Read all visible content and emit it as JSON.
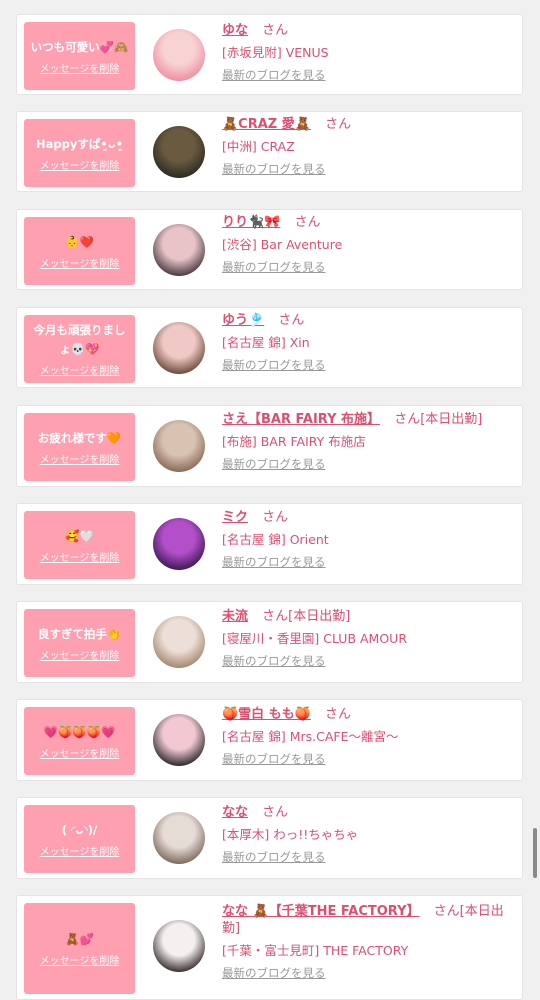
{
  "messages": [
    {
      "text": "いつも可愛い💞🙈",
      "delete": "メッセージを削除",
      "name": "ゆな",
      "san": "さん",
      "shop": "[赤坂見附] VENUS",
      "blog": "最新のブログを見る",
      "avatar_colors": [
        "#f7d3d3",
        "#f08ea0"
      ]
    },
    {
      "text": "Happyすぱ•͈ᴗ•͈",
      "delete": "メッセージを削除",
      "name": "🧸CRAZ 愛🧸",
      "san": "さん",
      "shop": "[中洲] CRAZ",
      "blog": "最新のブログを見る",
      "avatar_colors": [
        "#6a5a3f",
        "#2b2a22"
      ]
    },
    {
      "text": "👶❤️",
      "delete": "メッセージを削除",
      "name": "りり🐈‍⬛🎀",
      "san": "さん",
      "shop": "[渋谷] Bar Aventure",
      "blog": "最新のブログを見る",
      "avatar_colors": [
        "#e8c4c8",
        "#4a3a40"
      ]
    },
    {
      "text": "今月も頑張りましょ💀💖",
      "delete": "メッセージを削除",
      "name": "ゆう🎐",
      "san": "さん",
      "shop": "[名古屋 錦] Xin",
      "blog": "最新のブログを見る",
      "avatar_colors": [
        "#f0c9c6",
        "#6b4a3a"
      ]
    },
    {
      "text": "お疲れ様です🧡",
      "delete": "メッセージを削除",
      "name": "さえ【BAR FAIRY 布施】",
      "san": "さん[本日出勤]",
      "shop": "[布施] BAR FAIRY 布施店",
      "blog": "最新のブログを見る",
      "avatar_colors": [
        "#d8c3b3",
        "#8a6a55"
      ]
    },
    {
      "text": "🥰🤍",
      "delete": "メッセージを削除",
      "name": "ミク",
      "san": "さん",
      "shop": "[名古屋 錦] Orient",
      "blog": "最新のブログを見る",
      "avatar_colors": [
        "#b34fc9",
        "#3c1a55"
      ]
    },
    {
      "text": "良すぎて拍手👏",
      "delete": "メッセージを削除",
      "name": "未流",
      "san": "さん[本日出勤]",
      "shop": "[寝屋川・香里園] CLUB AMOUR",
      "blog": "最新のブログを見る",
      "avatar_colors": [
        "#ecdfd7",
        "#a4876f"
      ]
    },
    {
      "text": "💗🍑🍑🍑💗",
      "delete": "メッセージを削除",
      "name": "🍑雪白 もも🍑",
      "san": "さん",
      "shop": "[名古屋 錦] Mrs.CAFE〜離宮〜",
      "blog": "最新のブログを見る",
      "avatar_colors": [
        "#f2c9d3",
        "#2e2a2c"
      ]
    },
    {
      "text": "(  ◜ᴗ◝)/",
      "delete": "メッセージを削除",
      "name": "なな",
      "san": "さん",
      "shop": "[本厚木] わっ!!ちゃちゃ",
      "blog": "最新のブログを見る",
      "avatar_colors": [
        "#e6dcd6",
        "#7e6a5e"
      ]
    },
    {
      "text": "🧸💕",
      "delete": "メッセージを削除",
      "name": "なな 🧸【千葉THE FACTORY】",
      "san": "さん[本日出勤]",
      "shop": "[千葉・富士見町] THE FACTORY",
      "blog": "最新のブログを見る",
      "avatar_colors": [
        "#f5f0f0",
        "#3a3030"
      ]
    }
  ]
}
